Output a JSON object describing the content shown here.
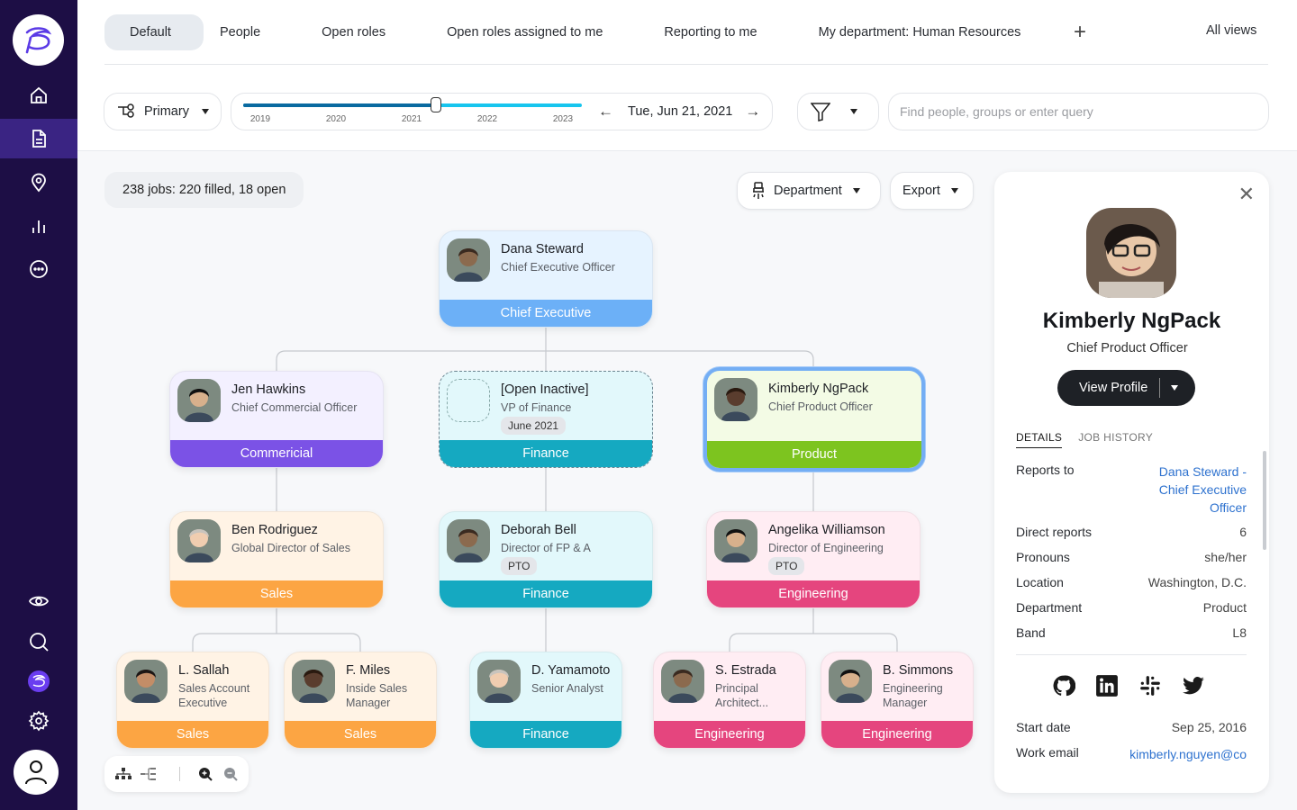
{
  "sidebar": {
    "top_items": [
      {
        "icon": "home-icon",
        "active": false
      },
      {
        "icon": "document-icon",
        "active": true
      },
      {
        "icon": "location-pin-icon",
        "active": false
      },
      {
        "icon": "bar-chart-icon",
        "active": false
      },
      {
        "icon": "more-icon",
        "active": false
      }
    ],
    "bottom_items": [
      {
        "icon": "eye-icon"
      },
      {
        "icon": "search-icon"
      },
      {
        "icon": "app-logo-icon"
      },
      {
        "icon": "gear-icon"
      }
    ],
    "colors": {
      "background": "#1d0e45",
      "active": "#3a2483"
    }
  },
  "views": {
    "tabs": [
      {
        "label": "Default",
        "active": true
      },
      {
        "label": "People"
      },
      {
        "label": "Open roles"
      },
      {
        "label": "Open roles assigned to me"
      },
      {
        "label": "Reporting to me"
      },
      {
        "label": "My department: Human Resources"
      }
    ],
    "add_label": "+",
    "all_views_label": "All views"
  },
  "toolbar": {
    "hierarchy_label": "Primary",
    "timeline": {
      "years": [
        "2019",
        "2020",
        "2021",
        "2022",
        "2023"
      ],
      "position_fraction": 0.57
    },
    "date_label": "Tue, Jun 21, 2021",
    "prev_arrow": "←",
    "next_arrow": "→",
    "search_placeholder": "Find people, groups or enter query"
  },
  "chart_toolbar": {
    "summary": "238 jobs: 220 filled, 18 open",
    "group_by_label": "Department",
    "export_label": "Export"
  },
  "org": {
    "level0": [
      {
        "name": "Dana Steward",
        "title": "Chief Executive Officer",
        "dept": "Chief Executive",
        "bg": "#e6f3ff",
        "color": "#6cb0f7"
      }
    ],
    "level1": [
      {
        "name": "Jen Hawkins",
        "title": "Chief Commercial Officer",
        "dept": "Commericial",
        "bg": "#f3f0ff",
        "color": "#7b52e6"
      },
      {
        "name": "[Open Inactive]",
        "title": "VP of Finance",
        "badge": "June 2021",
        "dept": "Finance",
        "bg": "#e2f8fb",
        "color": "#15a9c1"
      },
      {
        "name": "Kimberly NgPack",
        "title": "Chief Product Officer",
        "dept": "Product",
        "bg": "#f3fbe5",
        "color": "#7dc41f"
      }
    ],
    "level2": [
      {
        "name": "Ben Rodriguez",
        "title": "Global Director of Sales",
        "dept": "Sales",
        "bg": "#fff3e5",
        "color": "#fca543"
      },
      {
        "name": "Deborah Bell",
        "title": "Director of FP & A",
        "badge": "PTO",
        "dept": "Finance",
        "bg": "#e2f8fb",
        "color": "#15a9c1"
      },
      {
        "name": "Angelika Williamson",
        "title": "Director of Engineering",
        "badge": "PTO",
        "dept": "Engineering",
        "bg": "#ffedf3",
        "color": "#e5457e"
      }
    ],
    "level3": [
      {
        "name": "L. Sallah",
        "title": "Sales Account Executive",
        "dept": "Sales",
        "bg": "#fff3e5",
        "color": "#fca543"
      },
      {
        "name": "F. Miles",
        "title": "Inside Sales Manager",
        "dept": "Sales",
        "bg": "#fff3e5",
        "color": "#fca543"
      },
      {
        "name": "D. Yamamoto",
        "title": "Senior Analyst",
        "dept": "Finance",
        "bg": "#e2f8fb",
        "color": "#15a9c1"
      },
      {
        "name": "S. Estrada",
        "title": "Principal Architect...",
        "dept": "Engineering",
        "bg": "#ffedf3",
        "color": "#e5457e"
      },
      {
        "name": "B. Simmons",
        "title": "Engineering Manager",
        "dept": "Engineering",
        "bg": "#ffedf3",
        "color": "#e5457e"
      }
    ]
  },
  "zoom_controls": [
    "org-tree-icon",
    "list-tree-icon",
    "zoom-in-icon",
    "zoom-out-icon"
  ],
  "profile": {
    "name": "Kimberly NgPack",
    "title": "Chief Product Officer",
    "view_profile_label": "View Profile",
    "tabs": [
      {
        "label": "DETAILS",
        "active": true
      },
      {
        "label": "JOB HISTORY"
      }
    ],
    "details": [
      {
        "label": "Reports to",
        "value": "Dana Steward - Chief Executive Officer",
        "link": true
      },
      {
        "label": "Direct reports",
        "value": "6"
      },
      {
        "label": "Pronouns",
        "value": "she/her"
      },
      {
        "label": "Location",
        "value": "Washington, D.C."
      },
      {
        "label": "Department",
        "value": "Product"
      },
      {
        "label": "Band",
        "value": "L8"
      }
    ],
    "socials": [
      "github-icon",
      "linkedin-icon",
      "slack-icon",
      "twitter-icon"
    ],
    "extra": [
      {
        "label": "Start date",
        "value": "Sep 25, 2016"
      },
      {
        "label": "Work email",
        "value": "kimberly.nguyen@co",
        "link": true
      }
    ]
  }
}
